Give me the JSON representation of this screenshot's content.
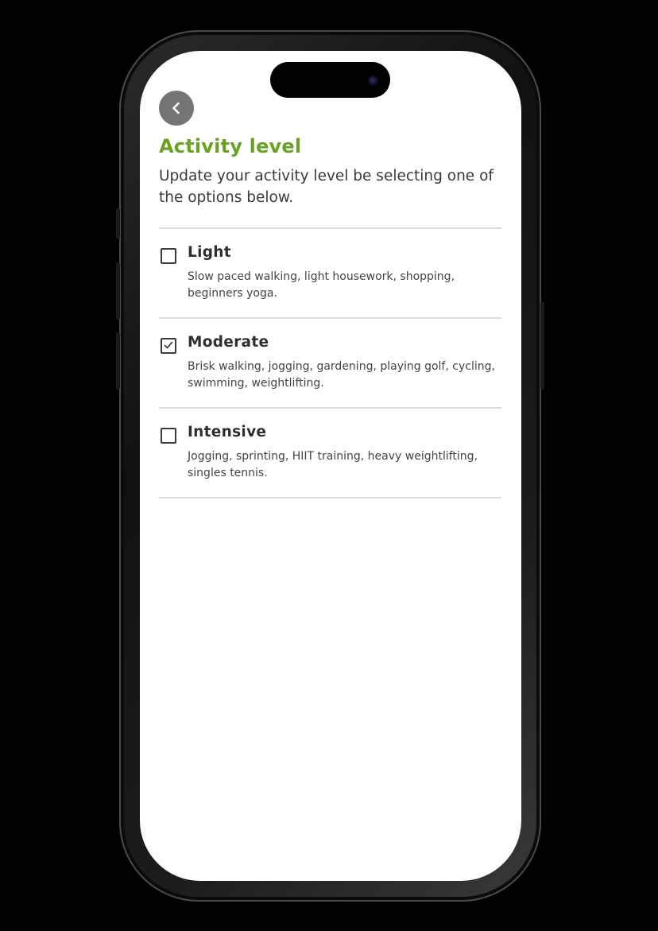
{
  "header": {
    "back_icon": "chevron-left-icon",
    "title": "Activity level",
    "subtitle": "Update your activity level be selecting one of the options below."
  },
  "options": [
    {
      "label": "Light",
      "description": "Slow paced walking, light housework, shopping, beginners yoga.",
      "checked": false
    },
    {
      "label": "Moderate",
      "description": "Brisk walking, jogging, gardening, playing golf, cycling, swimming, weightlifting.",
      "checked": true
    },
    {
      "label": "Intensive",
      "description": "Jogging, sprinting, HIIT training, heavy weightlifting, singles tennis.",
      "checked": false
    }
  ],
  "colors": {
    "title_green": "#6aa121",
    "back_button_bg": "#757575",
    "divider": "#dcdcdc"
  }
}
